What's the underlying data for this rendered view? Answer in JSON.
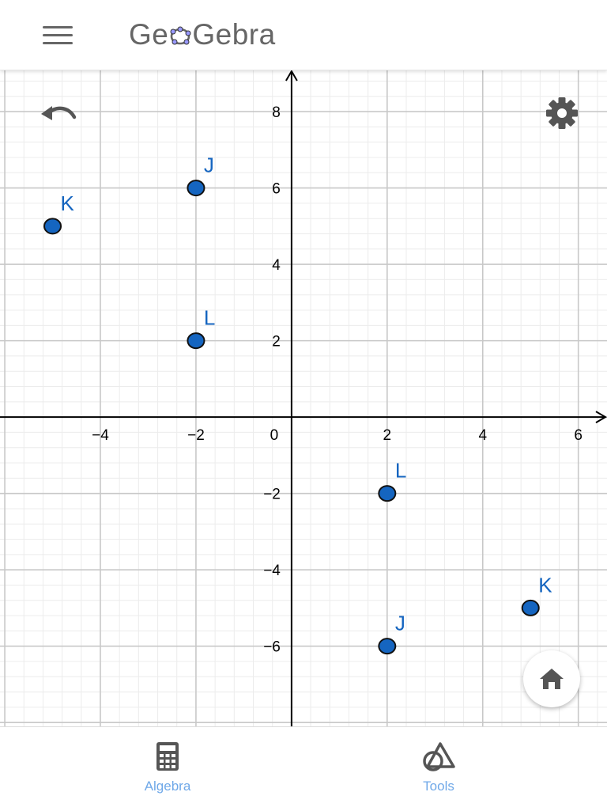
{
  "header": {
    "logo_prefix": "Ge",
    "logo_suffix": "Gebra",
    "menu_icon": "hamburger-menu-icon"
  },
  "toolbar": {
    "undo_icon": "undo-icon",
    "settings_icon": "gear-icon",
    "home_icon": "home-icon"
  },
  "colors": {
    "point_fill": "#1565c0",
    "point_label": "#1565c0",
    "axis": "#000000",
    "grid_major": "#c8c8c8",
    "grid_minor": "#ececec",
    "tab_label": "#6fa8e8",
    "icon_gray": "#555555"
  },
  "graph": {
    "x_range": [
      -6.1,
      6.6
    ],
    "y_range": [
      -8.1,
      9.1
    ],
    "x_tick_labels": [
      {
        "value": -4,
        "label": "−4"
      },
      {
        "value": -2,
        "label": "−2"
      },
      {
        "value": 2,
        "label": "2"
      },
      {
        "value": 4,
        "label": "4"
      },
      {
        "value": 6,
        "label": "6"
      }
    ],
    "y_tick_labels": [
      {
        "value": 8,
        "label": "8"
      },
      {
        "value": 6,
        "label": "6"
      },
      {
        "value": 4,
        "label": "4"
      },
      {
        "value": 2,
        "label": "2"
      },
      {
        "value": -2,
        "label": "−2"
      },
      {
        "value": -4,
        "label": "−4"
      },
      {
        "value": -6,
        "label": "−6"
      }
    ],
    "origin_label": "0",
    "points": [
      {
        "label": "J",
        "x": -2,
        "y": 6
      },
      {
        "label": "K",
        "x": -5,
        "y": 5
      },
      {
        "label": "L",
        "x": -2,
        "y": 2
      },
      {
        "label": "L",
        "x": 2,
        "y": -2
      },
      {
        "label": "K",
        "x": 5,
        "y": -5
      },
      {
        "label": "J",
        "x": 2,
        "y": -6
      }
    ]
  },
  "bottom_tabs": [
    {
      "label": "Algebra",
      "icon": "calculator-icon"
    },
    {
      "label": "Tools",
      "icon": "tools-shapes-icon"
    }
  ]
}
